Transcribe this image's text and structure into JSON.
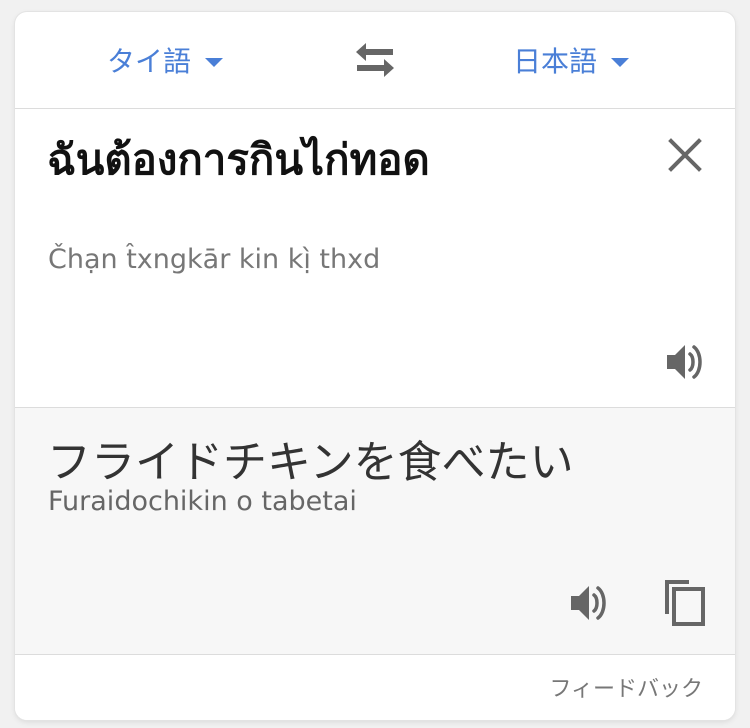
{
  "header": {
    "source_language": "タイ語",
    "target_language": "日本語"
  },
  "source": {
    "text": "ฉันต้องการกินไก่ทอด",
    "transliteration": "Čhạn t̂xngkār kin kị̀ thxd"
  },
  "target": {
    "text": "フライドチキンを食べたい",
    "transliteration": "Furaidochikin o tabetai"
  },
  "footer": {
    "feedback_label": "フィードバック"
  },
  "icons": {
    "source_dropdown": "chevron-down-icon",
    "target_dropdown": "chevron-down-icon",
    "swap": "swap-languages-icon",
    "clear": "close-icon",
    "speak_source": "speaker-icon",
    "speak_target": "speaker-icon",
    "copy": "copy-icon"
  },
  "colors": {
    "accent": "#4a7fd7",
    "icon": "#666666",
    "source_bg": "#ffffff",
    "target_bg": "#f7f7f7"
  }
}
